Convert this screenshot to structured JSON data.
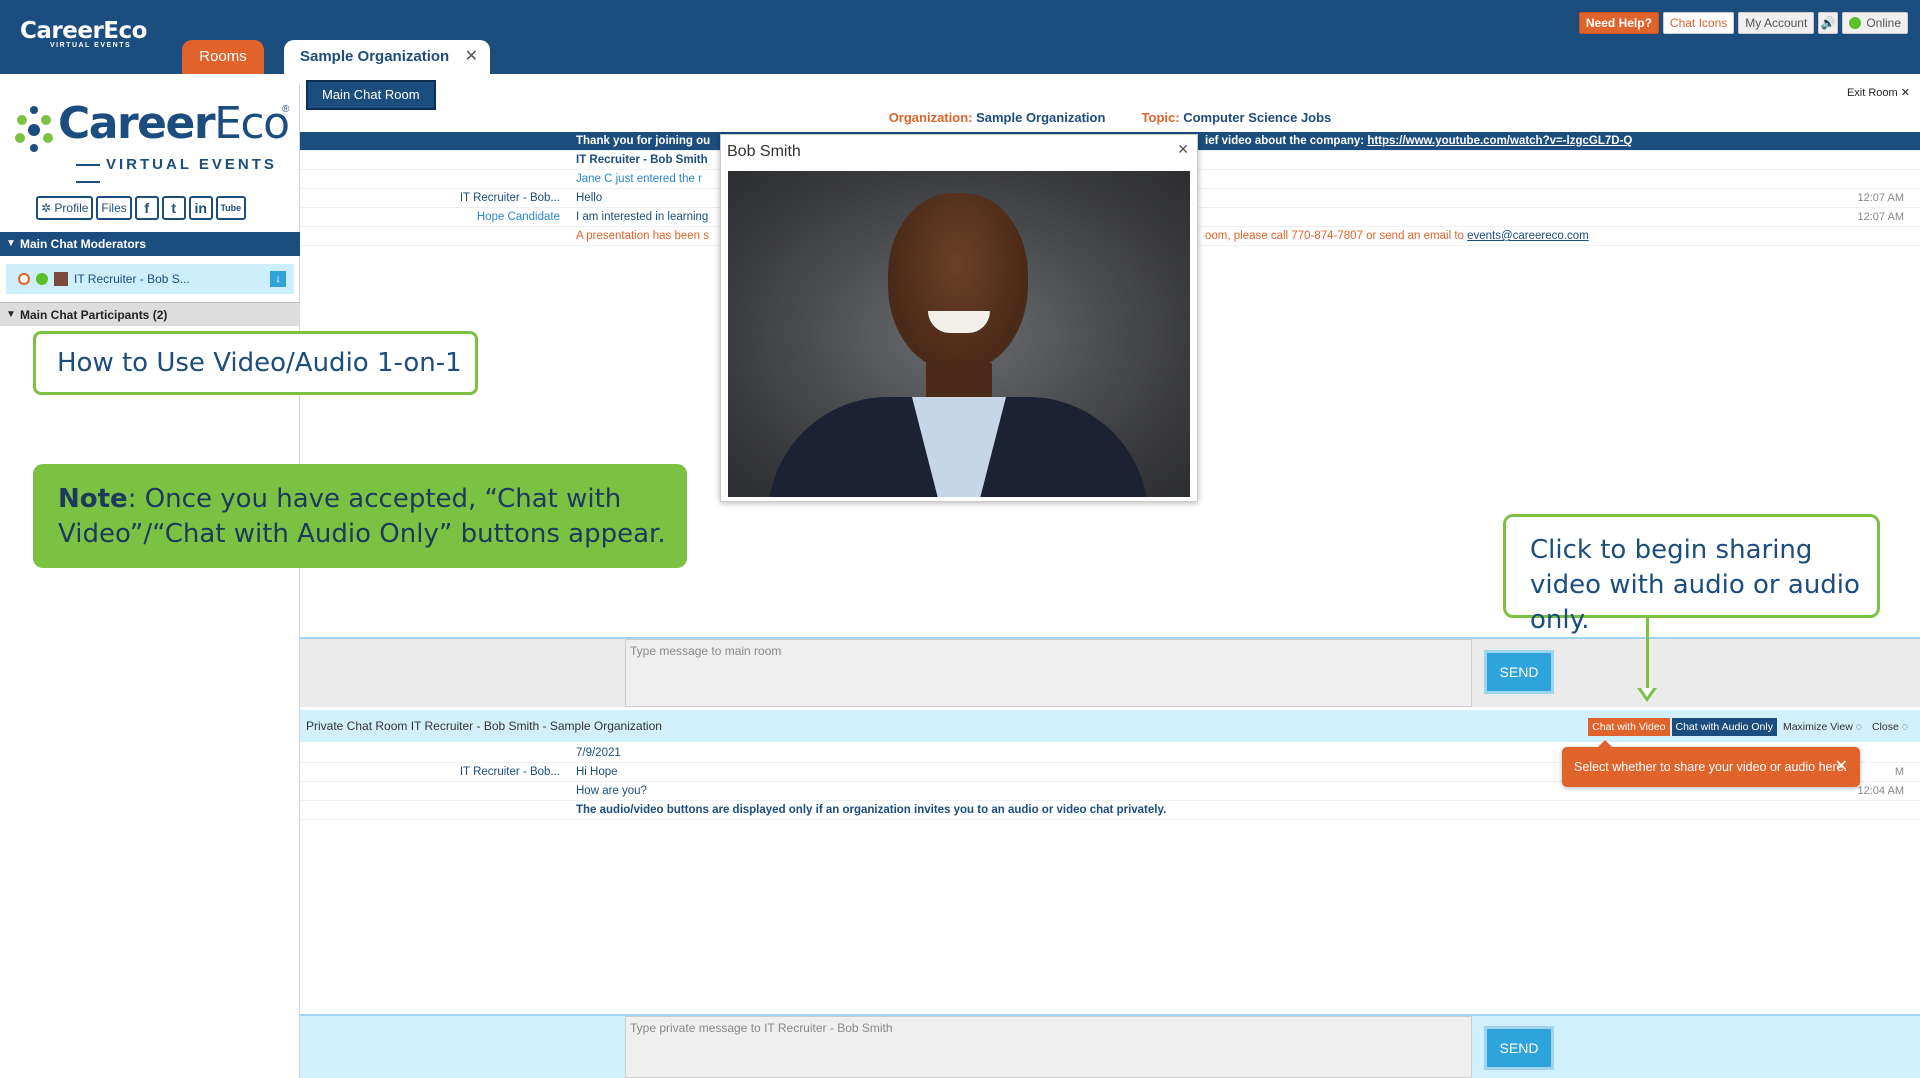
{
  "header": {
    "logo_brand": "CareerEco",
    "logo_sub": "VIRTUAL EVENTS",
    "tabs": [
      {
        "label": "Rooms"
      },
      {
        "label": "Sample Organization"
      }
    ],
    "buttons": {
      "help": "Need Help?",
      "chat_icons": "Chat Icons",
      "account": "My Account",
      "status": "Online"
    }
  },
  "sidebar": {
    "logo_brand_a": "Career",
    "logo_brand_b": "Eco",
    "logo_sub": "VIRTUAL EVENTS",
    "social": {
      "profile": "Profile",
      "files": "Files",
      "facebook": "f",
      "twitter": "t",
      "linkedin": "in",
      "youtube": "Tube"
    },
    "moderators_header": "Main Chat Moderators",
    "moderator_name": "IT Recruiter - Bob S...",
    "participants_header": "Main Chat Participants (2)"
  },
  "main": {
    "room_tab": "Main Chat Room",
    "exit_room": "Exit Room",
    "org_label": "Organization:",
    "org_value": "Sample Organization",
    "topic_label": "Topic:",
    "topic_value": "Computer Science Jobs",
    "messages": [
      {
        "who": "",
        "text": "Thank you for joining ou",
        "text2": "ief video about the company: ",
        "link": "https://www.youtube.com/watch?v=-lzgcGL7D-Q",
        "time": ""
      },
      {
        "who": "",
        "text": "IT Recruiter - Bob Smith",
        "time": ""
      },
      {
        "who": "",
        "text": "Jane C just entered the r",
        "time": ""
      },
      {
        "who": "IT Recruiter - Bob...",
        "text": "Hello",
        "time": "12:07 AM"
      },
      {
        "who": "Hope Candidate",
        "text": "I am interested in learning",
        "time": "12:07 AM"
      },
      {
        "who": "",
        "text": "A presentation has been s",
        "text2": "oom, please call 770-874-7807 or send an email to ",
        "link": "events@careereco.com",
        "time": ""
      }
    ],
    "input_placeholder": "Type message to main room",
    "send_label": "SEND"
  },
  "private": {
    "title": "Private Chat Room IT Recruiter - Bob Smith - Sample Organization",
    "chat_with_video": "Chat with Video",
    "chat_with_audio": "Chat with Audio Only",
    "maximize": "Maximize View",
    "close": "Close",
    "tooltip": "Select whether to share your video or audio here.",
    "messages": [
      {
        "who": "",
        "text": "7/9/2021",
        "time": ""
      },
      {
        "who": "IT Recruiter - Bob...",
        "text": "Hi Hope",
        "time": "M"
      },
      {
        "who": "",
        "text": "How are you?",
        "time": "12:04 AM"
      },
      {
        "who": "",
        "text": "The audio/video buttons are displayed only if an organization invites you to an audio or video chat privately.",
        "time": ""
      }
    ],
    "input_placeholder": "Type private message to IT Recruiter - Bob Smith",
    "send_label": "SEND"
  },
  "video": {
    "title": "Bob Smith"
  },
  "annotations": {
    "title": "How to Use Video/Audio 1-on-1",
    "note_bold": "Note",
    "note_text": ": Once you have accepted, “Chat with Video”/“Chat with Audio Only” buttons appear.",
    "callout": "Click to begin sharing video with audio or audio only."
  },
  "colors": {
    "brand_navy": "#1b4d7e",
    "accent_orange": "#e0632b",
    "annotation_green": "#7cc242",
    "send_blue": "#2ea3dc"
  }
}
